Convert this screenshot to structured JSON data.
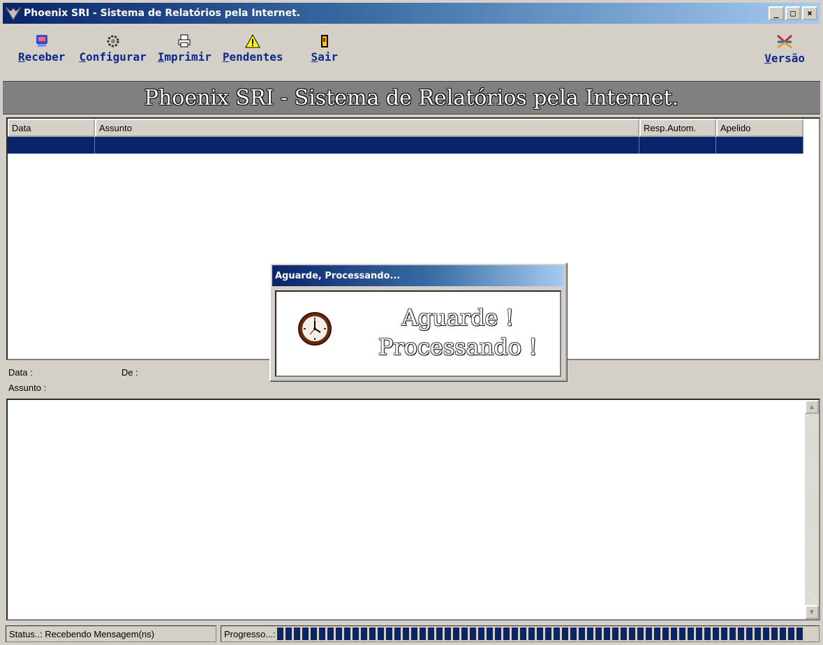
{
  "window": {
    "title": "Phoenix SRI - Sistema de Relatórios pela Internet.",
    "controls": {
      "minimize": "_",
      "maximize": "□",
      "close": "×"
    }
  },
  "toolbar": {
    "items": [
      {
        "id": "receber",
        "hotkey": "R",
        "rest": "eceber",
        "icon": "receive-icon"
      },
      {
        "id": "configurar",
        "hotkey": "C",
        "rest": "onfigurar",
        "icon": "gear-icon"
      },
      {
        "id": "imprimir",
        "hotkey": "I",
        "rest": "mprimir",
        "icon": "printer-icon"
      },
      {
        "id": "pendentes",
        "hotkey": "P",
        "rest": "endentes",
        "icon": "warning-icon"
      },
      {
        "id": "sair",
        "hotkey": "S",
        "rest": "air",
        "icon": "exit-door-icon"
      }
    ],
    "versao": {
      "hotkey": "V",
      "rest": "ersão",
      "icon": "version-logo-icon"
    }
  },
  "banner": {
    "text": "Phoenix SRI - Sistema de Relatórios pela Internet."
  },
  "list": {
    "columns": [
      "Data",
      "Assunto",
      "Resp.Autom.",
      "Apelido"
    ],
    "rows": [
      {
        "selected": true,
        "cells": [
          "",
          "",
          "",
          ""
        ]
      }
    ]
  },
  "message_header": {
    "data_label": "Data :",
    "de_label": "De :",
    "assunto_label": "Assunto :"
  },
  "statusbar": {
    "status": "Status..: Recebendo Mensagem(ns)",
    "progress_label": "Progresso...:",
    "progress_fraction": 1.0
  },
  "dialog": {
    "title": "Aguarde, Processando...",
    "line1": "Aguarde !",
    "line2": "Processando !",
    "icon": "clock-icon"
  },
  "colors": {
    "title_bar": "#0a246a",
    "selection": "#0a246a",
    "toolbar_text": "#0a2a8a",
    "banner_bg": "#808080"
  }
}
